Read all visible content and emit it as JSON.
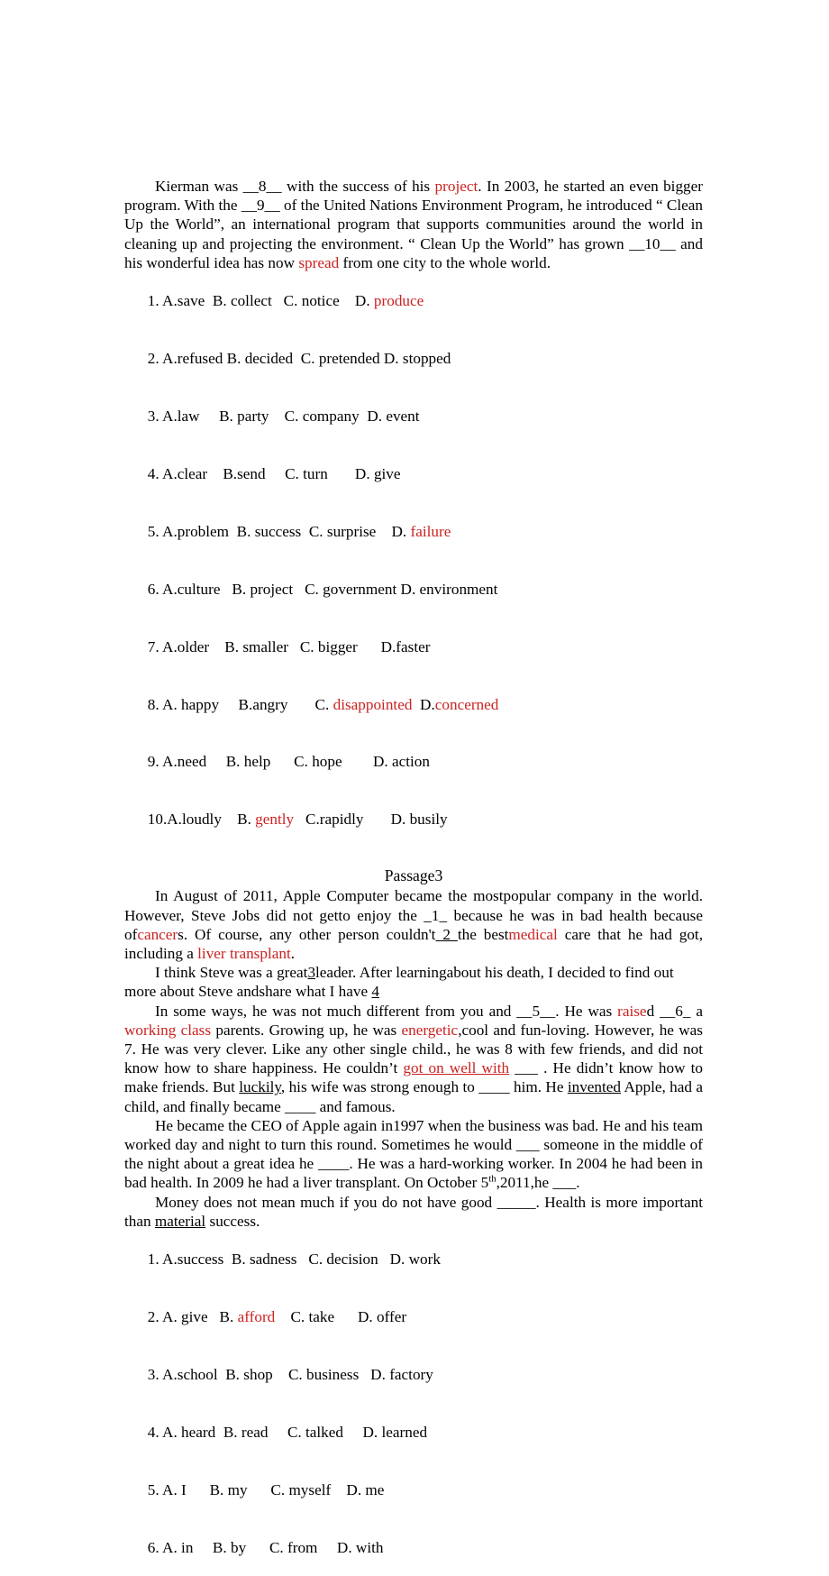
{
  "document": {
    "type": "english-cloze-worksheet",
    "accent_color": "#cc2222",
    "text_color": "#000000",
    "background_color": "#ffffff"
  },
  "passage2_continuation": {
    "body": "Kierman was __8__ with the success of his ",
    "body_red_1": "project",
    "body_2": ". In 2003, he started an even bigger program. With the __9__ of the United Nations Environment Program, he introduced “ Clean Up the World”, an international program that supports communities around the world in cleaning up and projecting the environment. “ Clean Up the World” has grown __10__ and his wonderful idea has now ",
    "body_red_2": "spread",
    "body_3": " from one city to the whole world."
  },
  "passage2_options": [
    {
      "number": "1.",
      "choices": [
        {
          "letter": "A.",
          "word": "save",
          "red": false,
          "gap": "  "
        },
        {
          "letter": "B. ",
          "word": "collect",
          "red": false,
          "gap": "   "
        },
        {
          "letter": "C. ",
          "word": "notice",
          "red": false,
          "gap": "    "
        },
        {
          "letter": "D. ",
          "word": "produce",
          "red": true,
          "gap": ""
        }
      ]
    },
    {
      "number": "2.",
      "choices": [
        {
          "letter": "A.",
          "word": "refused",
          "red": false,
          "gap": " "
        },
        {
          "letter": "B. ",
          "word": "decided",
          "red": false,
          "gap": "  "
        },
        {
          "letter": "C. ",
          "word": "pretended",
          "red": false,
          "gap": " "
        },
        {
          "letter": "D. ",
          "word": "stopped",
          "red": false,
          "gap": ""
        }
      ]
    },
    {
      "number": "3.",
      "choices": [
        {
          "letter": "A.",
          "word": "law",
          "red": false,
          "gap": "     "
        },
        {
          "letter": "B. ",
          "word": "party",
          "red": false,
          "gap": "    "
        },
        {
          "letter": "C. ",
          "word": "company",
          "red": false,
          "gap": "  "
        },
        {
          "letter": "D. ",
          "word": "event",
          "red": false,
          "gap": ""
        }
      ]
    },
    {
      "number": "4.",
      "choices": [
        {
          "letter": "A.",
          "word": "clear",
          "red": false,
          "gap": "    "
        },
        {
          "letter": "B.",
          "word": "send",
          "red": false,
          "gap": "     "
        },
        {
          "letter": "C. ",
          "word": "turn",
          "red": false,
          "gap": "       "
        },
        {
          "letter": "D. ",
          "word": "give",
          "red": false,
          "gap": ""
        }
      ]
    },
    {
      "number": "5.",
      "choices": [
        {
          "letter": "A.",
          "word": "problem",
          "red": false,
          "gap": "  "
        },
        {
          "letter": "B. ",
          "word": "success",
          "red": false,
          "gap": "  "
        },
        {
          "letter": "C. ",
          "word": "surprise",
          "red": false,
          "gap": "    "
        },
        {
          "letter": "D. ",
          "word": "failure",
          "red": true,
          "gap": ""
        }
      ]
    },
    {
      "number": "6.",
      "choices": [
        {
          "letter": "A.",
          "word": "culture",
          "red": false,
          "gap": "   "
        },
        {
          "letter": "B. ",
          "word": "project",
          "red": false,
          "gap": "   "
        },
        {
          "letter": "C. ",
          "word": "government",
          "red": false,
          "gap": " "
        },
        {
          "letter": "D. ",
          "word": "environment",
          "red": false,
          "gap": ""
        }
      ]
    },
    {
      "number": "7.",
      "choices": [
        {
          "letter": "A.",
          "word": "older",
          "red": false,
          "gap": "    "
        },
        {
          "letter": "B. ",
          "word": "smaller",
          "red": false,
          "gap": "   "
        },
        {
          "letter": "C. ",
          "word": "bigger",
          "red": false,
          "gap": "      "
        },
        {
          "letter": "D.",
          "word": "faster",
          "red": false,
          "gap": ""
        }
      ]
    },
    {
      "number": "8.",
      "choices": [
        {
          "letter": "A. ",
          "word": "happy",
          "red": false,
          "gap": "     "
        },
        {
          "letter": "B.",
          "word": "angry",
          "red": false,
          "gap": "       "
        },
        {
          "letter": "C. ",
          "word": "disappointed",
          "red": true,
          "gap": "  "
        },
        {
          "letter": "D.",
          "word": "concerned",
          "red": true,
          "gap": ""
        }
      ]
    },
    {
      "number": "9.",
      "choices": [
        {
          "letter": "A.",
          "word": "need",
          "red": false,
          "gap": "     "
        },
        {
          "letter": "B. ",
          "word": "help",
          "red": false,
          "gap": "      "
        },
        {
          "letter": "C. ",
          "word": "hope",
          "red": false,
          "gap": "        "
        },
        {
          "letter": "D. ",
          "word": "action",
          "red": false,
          "gap": ""
        }
      ]
    },
    {
      "number": "10.",
      "choices": [
        {
          "letter": "A.",
          "word": "loudly",
          "red": false,
          "gap": "    "
        },
        {
          "letter": "B. ",
          "word": "gently",
          "red": true,
          "gap": "   "
        },
        {
          "letter": "C.",
          "word": "rapidly",
          "red": false,
          "gap": "       "
        },
        {
          "letter": "D. ",
          "word": "busily",
          "red": false,
          "gap": ""
        }
      ]
    }
  ],
  "passage3": {
    "title": "Passage3",
    "p1_a": "In August of 2011, Apple Computer became the mostpopular company in the world. However, Steve Jobs did not getto enjoy the _1_ because he was in bad health because of",
    "p1_red_cancer": "cancer",
    "p1_b": "s. Of course, any other person couldn't",
    "p1_blank2": " 2 ",
    "p1_c": " the best",
    "p1_red_medical": "medical",
    "p1_d": " care that he had got, including a ",
    "p1_red_liver": "liver transplant",
    "p1_e": ".",
    "p2_a": "I think Steve was a great",
    "p2_blank3": "3",
    "p2_b": "leader. After learningabout his death, I decided to find out more about Steve andshare what I have ",
    "p2_blank4": "4",
    "p3_a": "In some ways, he was not much different from you and __5__. He was ",
    "p3_red_raise": "raise",
    "p3_b": "d __6_ a ",
    "p3_red_working": "working class",
    "p3_c": " parents. Growing up, he was ",
    "p3_red_energetic": "energetic",
    "p3_d": ",cool and fun-loving. However, he was 7. He was very clever. Like any other single child., he was 8 with few friends, and did not know how to share happiness. He couldn’t ",
    "p3_red_goton": "got on well with",
    "p3_e": " ___ . He didn’t know how to make friends. But ",
    "p3_u_luckily": "luckily",
    "p3_f": ", his wife was strong enough to ____ him. He ",
    "p3_u_invented": "invented",
    "p3_g": " Apple, had a child, and finally became ____ and famous.",
    "p4_a": "He became the CEO of Apple again in1997 when the business was bad. He and his team worked day and night to turn this round. Sometimes he would ___ someone in the middle of the night about a great idea he ____. He was a hard-working worker. In 2004 he had been in bad health. In 2009 he had a liver transplant. On October 5",
    "p4_sup": "th",
    "p4_b": ",2011,he ___.",
    "p5_a": "Money does not mean much if you do not have good _____. Health is more important than ",
    "p5_u_material": "material",
    "p5_b": " success."
  },
  "passage3_options": [
    {
      "number": "1.",
      "choices": [
        {
          "letter": "A.",
          "word": "success",
          "red": false,
          "gap": "  "
        },
        {
          "letter": "B. ",
          "word": "sadness",
          "red": false,
          "gap": "   "
        },
        {
          "letter": "C. ",
          "word": "decision",
          "red": false,
          "gap": "   "
        },
        {
          "letter": "D. ",
          "word": "work",
          "red": false,
          "gap": ""
        }
      ]
    },
    {
      "number": "2.",
      "choices": [
        {
          "letter": "A. ",
          "word": "give",
          "red": false,
          "gap": "   "
        },
        {
          "letter": "B. ",
          "word": "afford",
          "red": true,
          "gap": "    "
        },
        {
          "letter": "C. ",
          "word": "take",
          "red": false,
          "gap": "      "
        },
        {
          "letter": "D. ",
          "word": "offer",
          "red": false,
          "gap": ""
        }
      ]
    },
    {
      "number": "3.",
      "choices": [
        {
          "letter": "A.",
          "word": "school",
          "red": false,
          "gap": "  "
        },
        {
          "letter": "B. ",
          "word": "shop",
          "red": false,
          "gap": "    "
        },
        {
          "letter": "C. ",
          "word": "business",
          "red": false,
          "gap": "   "
        },
        {
          "letter": "D. ",
          "word": "factory",
          "red": false,
          "gap": ""
        }
      ]
    },
    {
      "number": "4.",
      "choices": [
        {
          "letter": "A. ",
          "word": "heard",
          "red": false,
          "gap": "  "
        },
        {
          "letter": "B. ",
          "word": "read",
          "red": false,
          "gap": "     "
        },
        {
          "letter": "C. ",
          "word": "talked",
          "red": false,
          "gap": "     "
        },
        {
          "letter": "D. ",
          "word": "learned",
          "red": false,
          "gap": ""
        }
      ]
    },
    {
      "number": "5.",
      "choices": [
        {
          "letter": "A. ",
          "word": "I",
          "red": false,
          "gap": "      "
        },
        {
          "letter": "B. ",
          "word": "my",
          "red": false,
          "gap": "      "
        },
        {
          "letter": "C. ",
          "word": "myself",
          "red": false,
          "gap": "    "
        },
        {
          "letter": "D. ",
          "word": "me",
          "red": false,
          "gap": ""
        }
      ]
    },
    {
      "number": "6.",
      "choices": [
        {
          "letter": "A. ",
          "word": "in",
          "red": false,
          "gap": "     "
        },
        {
          "letter": "B. ",
          "word": "by",
          "red": false,
          "gap": "      "
        },
        {
          "letter": "C. ",
          "word": "from",
          "red": false,
          "gap": "     "
        },
        {
          "letter": "D. ",
          "word": "with",
          "red": false,
          "gap": ""
        }
      ]
    }
  ]
}
